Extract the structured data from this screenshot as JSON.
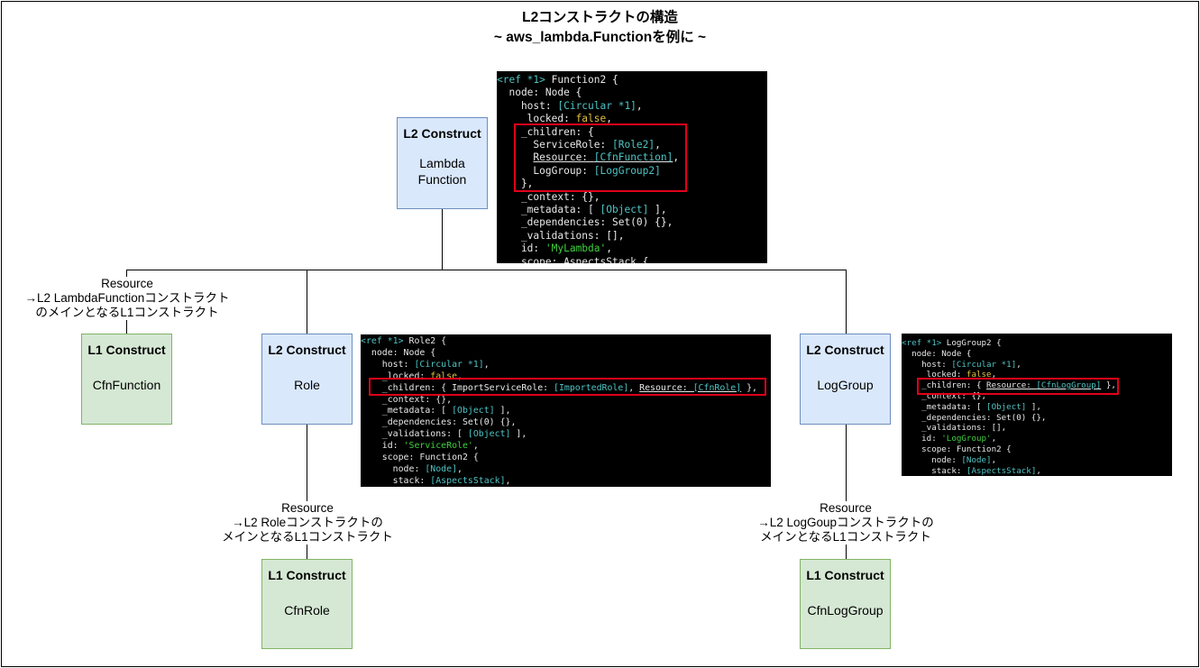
{
  "title": {
    "line1": "L2コンストラクトの構造",
    "line2": "~ aws_lambda.Functionを例に ~"
  },
  "nodes": {
    "lambda": {
      "kind": "L2 Construct",
      "name_line1": "Lambda",
      "name_line2": "Function"
    },
    "cfn_function": {
      "kind": "L1 Construct",
      "name": "CfnFunction"
    },
    "role": {
      "kind": "L2 Construct",
      "name": "Role"
    },
    "log_group": {
      "kind": "L2 Construct",
      "name": "LogGroup"
    },
    "cfn_role": {
      "kind": "L1 Construct",
      "name": "CfnRole"
    },
    "cfn_log_group": {
      "kind": "L1 Construct",
      "name": "CfnLogGroup"
    }
  },
  "edge_labels": {
    "function_resource": {
      "line1": "Resource",
      "line2": "→L2 LambdaFunctionコンストラクト",
      "line3": "のメインとなるL1コンストラクト"
    },
    "role_resource": {
      "line1": "Resource",
      "line2": "→L2 Roleコンストラクトの",
      "line3": "メインとなるL1コンストラクト"
    },
    "loggroup_resource": {
      "line1": "Resource",
      "line2": "→L2 LogGoupコンストラクトの",
      "line3": "メインとなるL1コンストラクト"
    }
  },
  "code": {
    "function": [
      "<ref *1> Function2 {",
      "  node: Node {",
      "    host: [Circular *1],",
      "    _locked: false,",
      "    _children: {",
      "      ServiceRole: [Role2],",
      "      Resource: [CfnFunction],",
      "      LogGroup: [LogGroup2]",
      "    },",
      "    _context: {},",
      "    _metadata: [ [Object] ],",
      "    _dependencies: Set(0) {},",
      "    _validations: [],",
      "    id: 'MyLambda',",
      "    scope: AspectsStack {"
    ],
    "role": [
      "<ref *1> Role2 {",
      "  node: Node {",
      "    host: [Circular *1],",
      "    _locked: false,",
      "    _children: { ImportServiceRole: [ImportedRole], Resource: [CfnRole] },",
      "    _context: {},",
      "    _metadata: [ [Object] ],",
      "    _dependencies: Set(0) {},",
      "    _validations: [ [Object] ],",
      "    id: 'ServiceRole',",
      "    scope: Function2 {",
      "      node: [Node],",
      "      stack: [AspectsStack],"
    ],
    "log_group": [
      "<ref *1> LogGroup2 {",
      "  node: Node {",
      "    host: [Circular *1],",
      "    _locked: false,",
      "    _children: { Resource: [CfnLogGroup] },",
      "    _context: {},",
      "    _metadata: [ [Object] ],",
      "    _dependencies: Set(0) {},",
      "    _validations: [],",
      "    id: 'LogGroup',",
      "    scope: Function2 {",
      "      node: [Node],",
      "      stack: [AspectsStack],"
    ]
  },
  "colors": {
    "l2_fill": "#dae8fc",
    "l2_border": "#6c8ebf",
    "l1_fill": "#d5e8d4",
    "l1_border": "#82b366",
    "highlight": "#e0001a",
    "code_bg": "#000000",
    "code_type": "#4fc3c3",
    "code_string": "#3fd13f",
    "code_bool": "#e0c040"
  }
}
